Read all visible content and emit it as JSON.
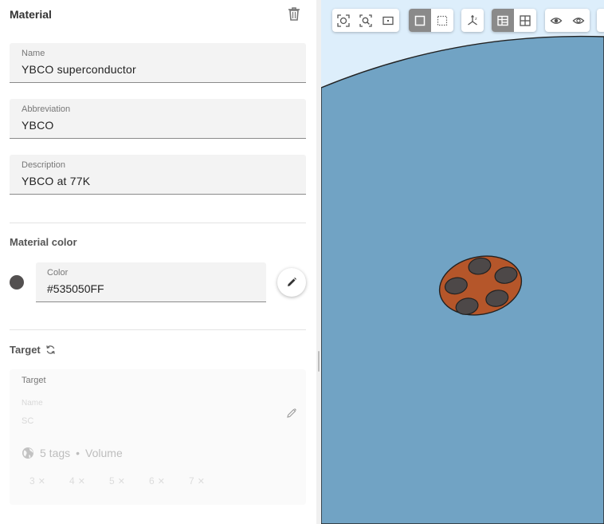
{
  "material": {
    "title": "Material",
    "name_label": "Name",
    "name_value": "YBCO superconductor",
    "abbr_label": "Abbreviation",
    "abbr_value": "YBCO",
    "desc_label": "Description",
    "desc_value": "YBCO at 77K"
  },
  "material_color": {
    "heading": "Material color",
    "label": "Color",
    "value": "#535050FF",
    "swatch": "#535050"
  },
  "target": {
    "heading": "Target",
    "card_title": "Target",
    "name_label": "Name",
    "name_value": "SC",
    "tags_text": "5 tags",
    "separator": "•",
    "type_text": "Volume",
    "chips": [
      "3",
      "4",
      "5",
      "6",
      "7"
    ]
  },
  "colors": {
    "outer_body": "#71a3c4",
    "background": "#ddeefb",
    "conductor": "#b5562a",
    "strands": "#4d4848"
  },
  "toolbar_icons": [
    "fit-all-icon",
    "zoom-fit-icon",
    "zoom-window-icon",
    "shaded-view-icon",
    "wireframe-view-icon",
    "axes-icon",
    "section-view-icon",
    "grid-view-icon",
    "show-icon",
    "hide-icon"
  ]
}
